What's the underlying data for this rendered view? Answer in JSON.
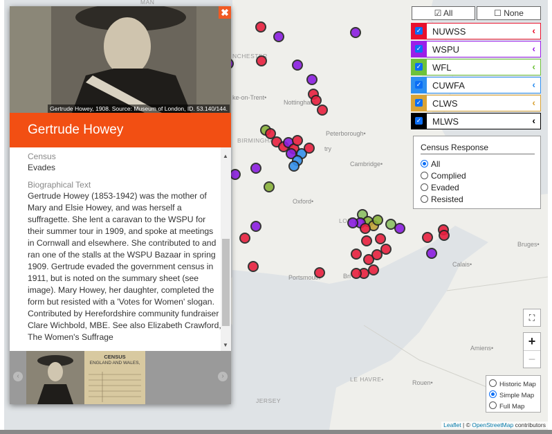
{
  "popup": {
    "photo_caption": "Gertrude Howey, 1908. Source: Museum of London, ID. 53.140/144.",
    "close_icon": "close-x-icon",
    "name": "Gertrude Howey",
    "census_label": "Census",
    "census_value": "Evades",
    "bio_label": "Biographical Text",
    "bio_text": "Gertrude Howey (1853-1942) was the mother of Mary and Elsie Howey, and was herself a suffragette. She lent a caravan to the WSPU for their summer tour in 1909, and spoke at meetings in Cornwall and elsewhere. She contributed to and ran one of the stalls at the WSPU Bazaar in spring 1909. Gertrude evaded the government census in 1911, but is noted on the summary sheet (see image). Mary Howey, her daughter, completed the form but resisted with a 'Votes for Women' slogan. Contributed by Herefordshire community fundraiser Clare Wichbold, MBE. See also Elizabeth Crawford, The Women's Suffrage",
    "gallery_doc_title": "CENSUS",
    "gallery_doc_sub": "ENGLAND AND WALES,"
  },
  "filters": {
    "all_label": "☑ All",
    "none_label": "☐ None",
    "layers": [
      {
        "label": "NUWSS",
        "color": "#e8112d"
      },
      {
        "label": "WSPU",
        "color": "#9b1ee8"
      },
      {
        "label": "WFL",
        "color": "#6ec23a"
      },
      {
        "label": "CUWFA",
        "color": "#2e8ff0"
      },
      {
        "label": "CLWS",
        "color": "#d9a336"
      },
      {
        "label": "MLWS",
        "color": "#000000"
      }
    ]
  },
  "census_response": {
    "title": "Census Response",
    "options": [
      "All",
      "Complied",
      "Evaded",
      "Resisted"
    ],
    "selected": "All"
  },
  "zoom": {
    "fullscreen_icon": "fullscreen-icon",
    "zoom_in": "+",
    "zoom_out": "−"
  },
  "map_type": {
    "options": [
      "Historic Map",
      "Simple Map",
      "Full Map"
    ],
    "selected": "Simple Map"
  },
  "attribution": {
    "leaflet": "Leaflet",
    "sep": " | © ",
    "osm": "OpenStreetMap",
    "suffix": " contributors"
  },
  "places": {
    "man": "MAN",
    "manchester": "NCHESTER",
    "stoke": "ke-on-Trent•",
    "nottingham": "Nottingham",
    "peterborough": "Peterborough•",
    "birmingham": "BIRMINGHA",
    "cambridge": "Cambridge•",
    "oxford": "Oxford•",
    "london": "LOND",
    "portsmouth": "Portsmouth",
    "brighton": "Bri",
    "calais": "Calais•",
    "bruges": "Bruges•",
    "amiens": "Amiens•",
    "lehavre": "LE HAVRE•",
    "rouen": "Rouen•",
    "jersey": "JERSEY",
    "try": "try"
  }
}
